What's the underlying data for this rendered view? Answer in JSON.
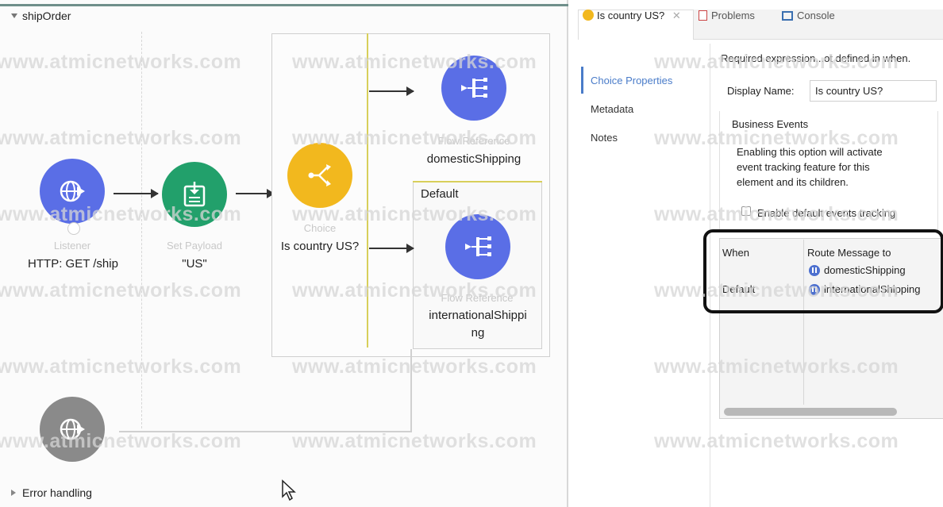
{
  "flow": {
    "name": "shipOrder",
    "error_section": "Error handling"
  },
  "nodes": {
    "listener": {
      "type": "Listener",
      "label": "HTTP: GET /ship",
      "icon": "globe-icon",
      "color": "#5a6ee6"
    },
    "set_payload": {
      "type": "Set Payload",
      "label": "\"US\"",
      "icon": "payload-icon",
      "color": "#22a06b"
    },
    "choice": {
      "type": "Choice",
      "label": "Is country US?",
      "icon": "branch-icon",
      "color": "#f2b81e"
    },
    "domestic_ref": {
      "type": "Flow Reference",
      "label": "domesticShipping",
      "icon": "flow-ref-icon",
      "color": "#5a6ee6"
    },
    "default_label": "Default",
    "international_ref": {
      "type": "Flow Reference",
      "label_line1": "internationalShippi",
      "label_line2": "ng",
      "icon": "flow-ref-icon",
      "color": "#5a6ee6"
    },
    "error_node": {
      "icon": "globe-icon",
      "color": "#8a8a8a"
    }
  },
  "watermark": "www.atmicnetworks.com",
  "panel": {
    "tabs": [
      {
        "label": "Is country US?",
        "icon": "choice-tab-icon",
        "active": true
      },
      {
        "label": "Problems",
        "icon": "problems-icon"
      },
      {
        "label": "Console",
        "icon": "console-icon"
      }
    ],
    "nav": [
      "Choice Properties",
      "Metadata",
      "Notes"
    ],
    "warning": "Required expression...ot defined in when.",
    "display_name_label": "Display Name:",
    "display_name_value": "Is country US?",
    "business_events_title": "Business Events",
    "business_events_desc": [
      "Enabling this option will activate",
      "event tracking feature for this",
      "element and its children."
    ],
    "checkbox_label": "Enable default events tracking",
    "table": {
      "headers": [
        "When",
        "Route Message to"
      ],
      "rows": [
        {
          "when": "",
          "route": "domesticShipping"
        },
        {
          "when": "Default",
          "route": "internationalShipping"
        }
      ]
    }
  },
  "colors": {
    "accent": "#4a7cc9",
    "choice_line": "#d8cf5a"
  }
}
